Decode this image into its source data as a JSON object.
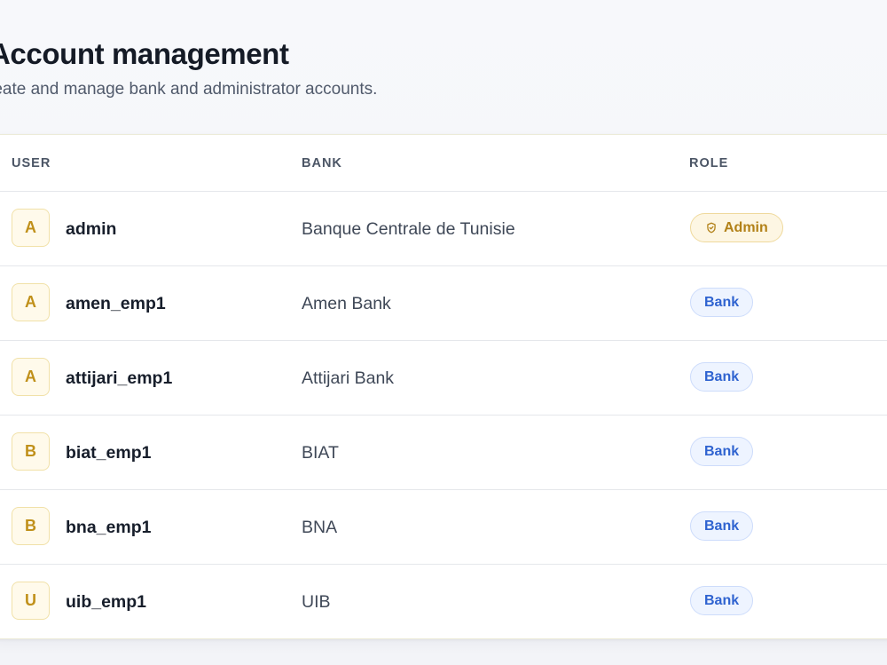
{
  "header": {
    "title": "Account management",
    "subtitle": "reate and manage bank and administrator accounts."
  },
  "table": {
    "columns": {
      "user": "USER",
      "bank": "BANK",
      "role": "ROLE"
    },
    "rows": [
      {
        "initial": "A",
        "username": "admin",
        "bank": "Banque Centrale de Tunisie",
        "role": "Admin",
        "role_icon": "shield-check-icon"
      },
      {
        "initial": "A",
        "username": "amen_emp1",
        "bank": "Amen Bank",
        "role": "Bank"
      },
      {
        "initial": "A",
        "username": "attijari_emp1",
        "bank": "Attijari Bank",
        "role": "Bank"
      },
      {
        "initial": "B",
        "username": "biat_emp1",
        "bank": "BIAT",
        "role": "Bank"
      },
      {
        "initial": "B",
        "username": "bna_emp1",
        "bank": "BNA",
        "role": "Bank"
      },
      {
        "initial": "U",
        "username": "uib_emp1",
        "bank": "UIB",
        "role": "Bank"
      }
    ]
  },
  "colors": {
    "avatar_text": "#c0901a",
    "avatar_bg": "#fffaeb",
    "admin_badge_text": "#b28118",
    "admin_badge_bg": "#fdf6e3",
    "bank_badge_text": "#2f63d0",
    "bank_badge_bg": "#eef4ff"
  }
}
